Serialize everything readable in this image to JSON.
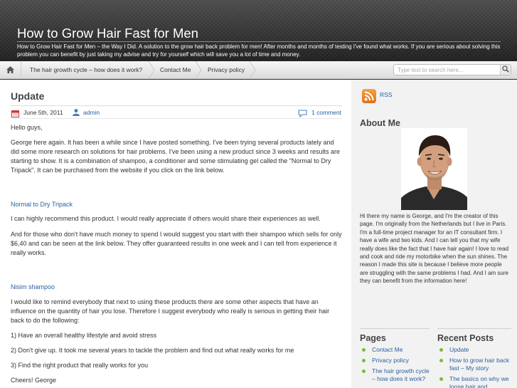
{
  "header": {
    "title": "How to Grow Hair Fast for Men",
    "description": "How to Grow Hair Fast for Men – the Way I Did. A solution to the grow hair back problem for men! After months and months of testing I've found what works. If you are serious about solving this problem you can benefit by just taking my advise and try for yourself which will save you a lot of time and money."
  },
  "nav": {
    "home_icon": "home-icon",
    "items": [
      {
        "label": "The hair growth cycle – how does it work?"
      },
      {
        "label": "Contact Me"
      },
      {
        "label": "Privacy policy"
      }
    ],
    "search": {
      "placeholder": "Type text to search here...",
      "icon": "search-icon"
    }
  },
  "post": {
    "title": "Update",
    "date": "June 5th, 2011",
    "author": "admin",
    "comments": "1 comment",
    "paragraphs": [
      "Hello guys,",
      "George here again. It has been a while since I have posted something. I've been trying several products lately and did some more research on solutions for hair problems. I've been using a new product since 3 weeks and results are starting to show. It is a combination of shampoo, a conditioner and some stimulating gel called the \"Normal to Dry Tripack\". It can be purchased from the website if you click on the link below.",
      "Normal to Dry Tripack",
      "I can highly recommend this product. I would really appreciate if others would share their experiences as well.",
      "And for those who don't have much money to spend I would suggest you start with their shampoo which sells for only $6,40 and can be seen at the link below. They offer guaranteed results in one week and I can tell from experience it really works.",
      "Nisim shampoo",
      "I would like to remind everybody that next to using these products there are some other aspects that have an influence on the quantity of hair you lose. Therefore I suggest everybody who really is serious in getting their hair back to do the following:",
      "1) Have an overall healthy lifestyle and avoid stress",
      "2) Don't give up. It took me several years to tackle the problem and find out what really works for me",
      "3) Find the right product that really works for you",
      "Cheers! George"
    ]
  },
  "sidebar": {
    "rss_label": "RSS",
    "about_title": "About Me",
    "about_text": "Hi there my name is George, and I'm the creator of this page. I'm originally from the Netherlands but I live in Paris. I'm a full-time project manager for an IT consultant firm. I have a wife and two kids. And I can tell you that my wife really does like the fact that I have hair again! I love to read and cook and ride my motorbike when the sun shines. The reason I made this site is because I believe more people are struggling with the same problems I had. And I am sure they can benefit from the information here!",
    "pages_title": "Pages",
    "pages": [
      "Contact Me",
      "Privacy policy",
      "The hair growth cycle – how does it work?"
    ],
    "recent_title": "Recent Posts",
    "recent": [
      "Update",
      "How to grow hair back fast – My story",
      "The basics on why we loose hair and"
    ]
  },
  "colors": {
    "link": "#2b5fa0",
    "bullet": "#7fb93a",
    "header_bg": "#2a2a2a",
    "rss": "#f08a2a"
  }
}
